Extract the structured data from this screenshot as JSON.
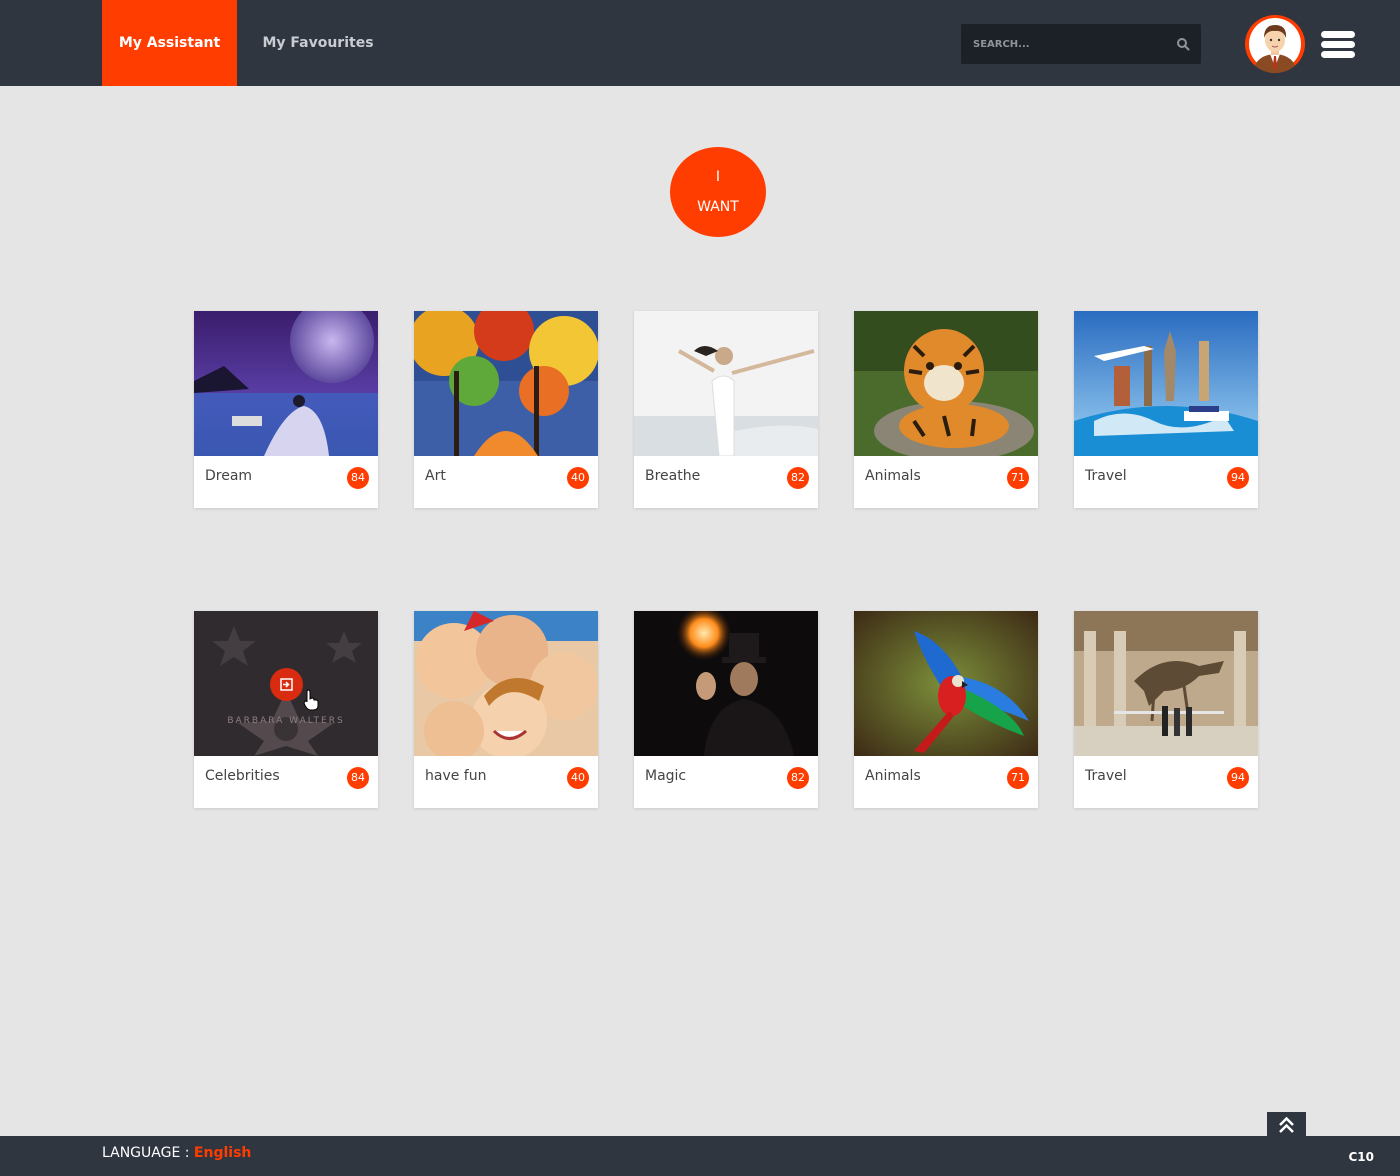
{
  "header": {
    "tabs": [
      {
        "label": "My Assistant",
        "active": true
      },
      {
        "label": "My Favourites",
        "active": false
      }
    ],
    "search": {
      "placeholder": "SEARCH..."
    },
    "icons": {
      "search": "search-icon",
      "avatar": "user-avatar",
      "menu": "hamburger-menu-icon"
    }
  },
  "want_button": {
    "line1": "I",
    "line2": "WANT"
  },
  "categories": [
    {
      "label": "Dream",
      "count": "84",
      "image": "woman-by-moonlit-lake"
    },
    {
      "label": "Art",
      "count": "40",
      "image": "colorful-painted-trees"
    },
    {
      "label": "Breathe",
      "count": "82",
      "image": "woman-on-beach-arms-open"
    },
    {
      "label": "Animals",
      "count": "71",
      "image": "tiger-cub"
    },
    {
      "label": "Travel",
      "count": "94",
      "image": "world-landmarks-collage"
    },
    {
      "label": "Celebrities",
      "count": "84",
      "image": "walk-of-fame-star"
    },
    {
      "label": "have fun",
      "count": "40",
      "image": "kids-smiling-circle"
    },
    {
      "label": "Magic",
      "count": "82",
      "image": "magician-top-hat-fire"
    },
    {
      "label": "Animals",
      "count": "71",
      "image": "flying-macaw"
    },
    {
      "label": "Travel",
      "count": "94",
      "image": "museum-dinosaur-skeleton"
    }
  ],
  "footer": {
    "language_label": "LANGUAGE :",
    "language_value": "English",
    "page_code": "C10"
  },
  "colors": {
    "accent": "#ff3d00",
    "header_bg": "#2f3640",
    "page_bg": "#e5e5e5"
  }
}
